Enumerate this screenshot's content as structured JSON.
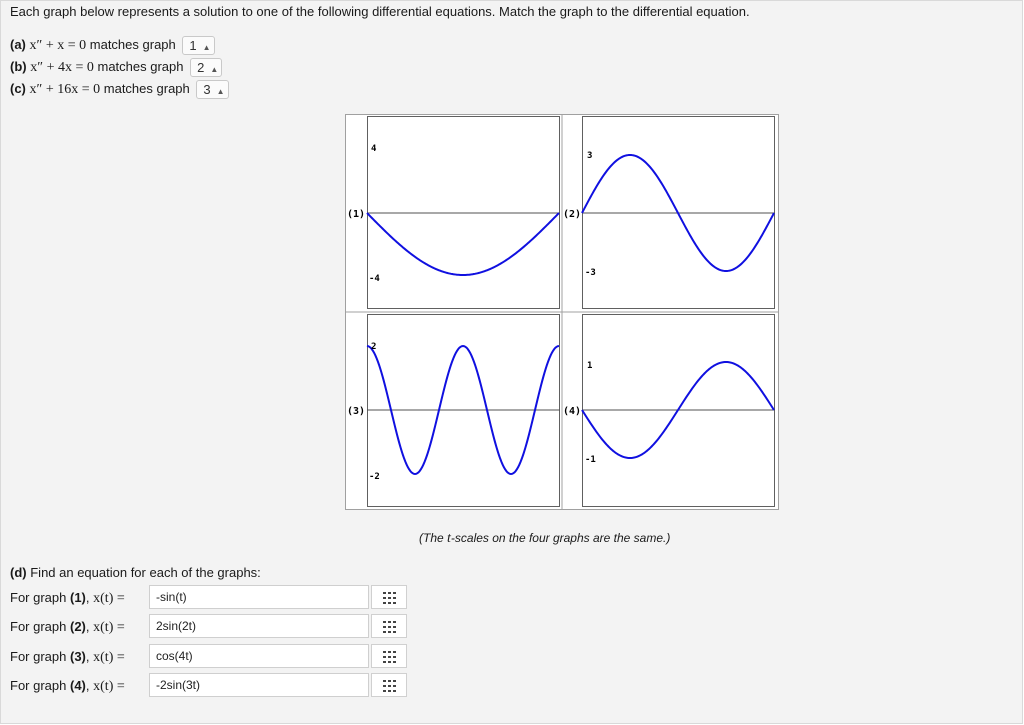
{
  "instructions": "Each graph below represents a solution to one of the following differential equations. Match the graph to the differential equation.",
  "matches": [
    {
      "part": "(a)",
      "equation": "x″ + x = 0",
      "connector": "matches graph",
      "value": "1"
    },
    {
      "part": "(b)",
      "equation": "x″ + 4x = 0",
      "connector": "matches graph",
      "value": "2"
    },
    {
      "part": "(c)",
      "equation": "x″ + 16x = 0",
      "connector": "matches graph",
      "value": "3"
    }
  ],
  "graphs": [
    {
      "label": "(1)",
      "ymax": "4",
      "ymin": "-4"
    },
    {
      "label": "(2)",
      "ymax": "3",
      "ymin": "-3"
    },
    {
      "label": "(3)",
      "ymax": "2",
      "ymin": "-2"
    },
    {
      "label": "(4)",
      "ymax": "1",
      "ymin": "-1"
    }
  ],
  "caption_pre": "(The ",
  "caption_var": "t",
  "caption_post": "-scales on the four graphs are the same.)",
  "part_d": {
    "label": "(d)",
    "title": "Find an equation for each of the graphs:",
    "rows": [
      {
        "prefix": "For graph",
        "label": "(1)",
        "fn": "x(t) =",
        "value": "-sin(t)"
      },
      {
        "prefix": "For graph",
        "label": "(2)",
        "fn": "x(t) =",
        "value": "2sin(2t)"
      },
      {
        "prefix": "For graph",
        "label": "(3)",
        "fn": "x(t) =",
        "value": "cos(4t)"
      },
      {
        "prefix": "For graph",
        "label": "(4)",
        "fn": "x(t) =",
        "value": "-2sin(3t)"
      }
    ]
  },
  "icons": {
    "select_arrows": "updown-arrows-icon",
    "palette_button": "grid-icon"
  },
  "colors": {
    "curve": "#1010e0",
    "panel": "#f3f3f3"
  }
}
